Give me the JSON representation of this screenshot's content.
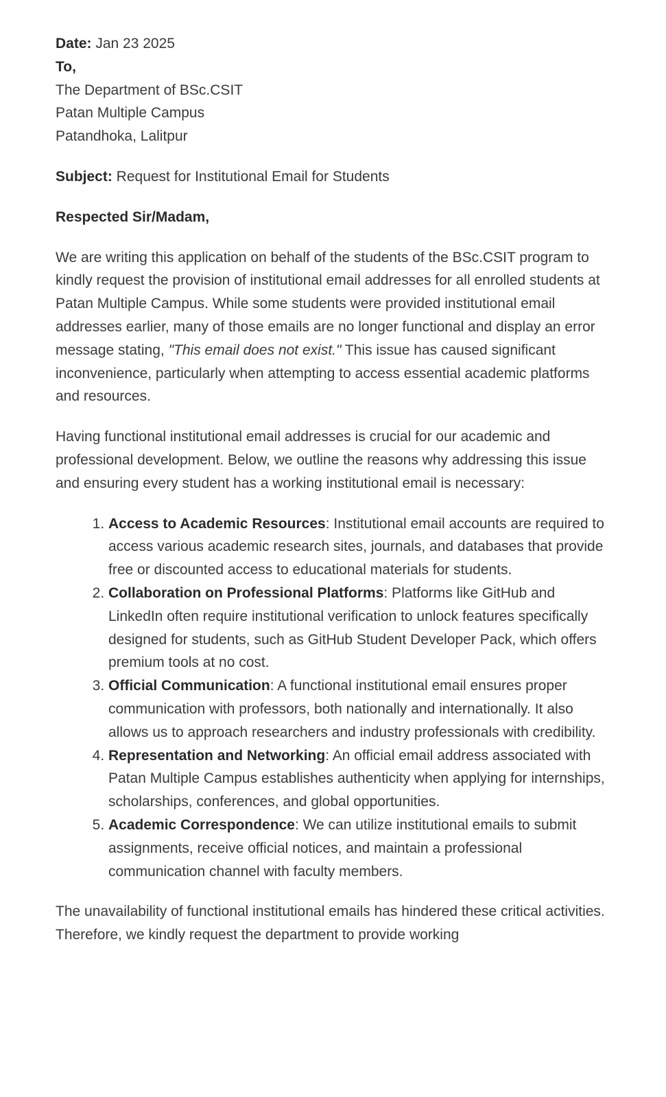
{
  "header": {
    "date_label": "Date:",
    "date_value": " Jan 23 2025",
    "to_label": "To,",
    "address": [
      "The Department of BSc.CSIT",
      "Patan Multiple Campus",
      "Patandhoka, Lalitpur"
    ]
  },
  "subject": {
    "label": "Subject:",
    "value": " Request for Institutional Email for Students"
  },
  "salutation": "Respected Sir/Madam,",
  "para1": {
    "before": "We are writing this application on behalf of the students of the BSc.CSIT program to kindly request the provision of institutional email addresses for all enrolled students at Patan Multiple Campus. While some students were provided institutional email addresses earlier, many of those emails are no longer functional and display an error message stating, ",
    "quote": "\"This email does not exist.\"",
    "after": " This issue has caused significant inconvenience, particularly when attempting to access essential academic platforms and resources."
  },
  "para2": "Having functional institutional email addresses is crucial for our academic and professional development. Below, we outline the reasons why addressing this issue and ensuring every student has a working institutional email is necessary:",
  "reasons": [
    {
      "title": "Access to Academic Resources",
      "text": ": Institutional email accounts are required to access various academic research sites, journals, and databases that provide free or discounted access to educational materials for students."
    },
    {
      "title": "Collaboration on Professional Platforms",
      "text": ": Platforms like GitHub and LinkedIn often require institutional verification to unlock features specifically designed for students, such as GitHub Student Developer Pack, which offers premium tools at no cost."
    },
    {
      "title": "Official Communication",
      "text": ": A functional institutional email ensures proper communication with professors, both nationally and internationally. It also allows us to approach researchers and industry professionals with credibility."
    },
    {
      "title": "Representation and Networking",
      "text": ": An official email address associated with Patan Multiple Campus establishes authenticity when applying for internships, scholarships, conferences, and global opportunities."
    },
    {
      "title": "Academic Correspondence",
      "text": ": We can utilize institutional emails to submit assignments, receive official notices, and maintain a professional communication channel with faculty members."
    }
  ],
  "para3": "The unavailability of functional institutional emails has hindered these critical activities. Therefore, we kindly request the department to provide working"
}
